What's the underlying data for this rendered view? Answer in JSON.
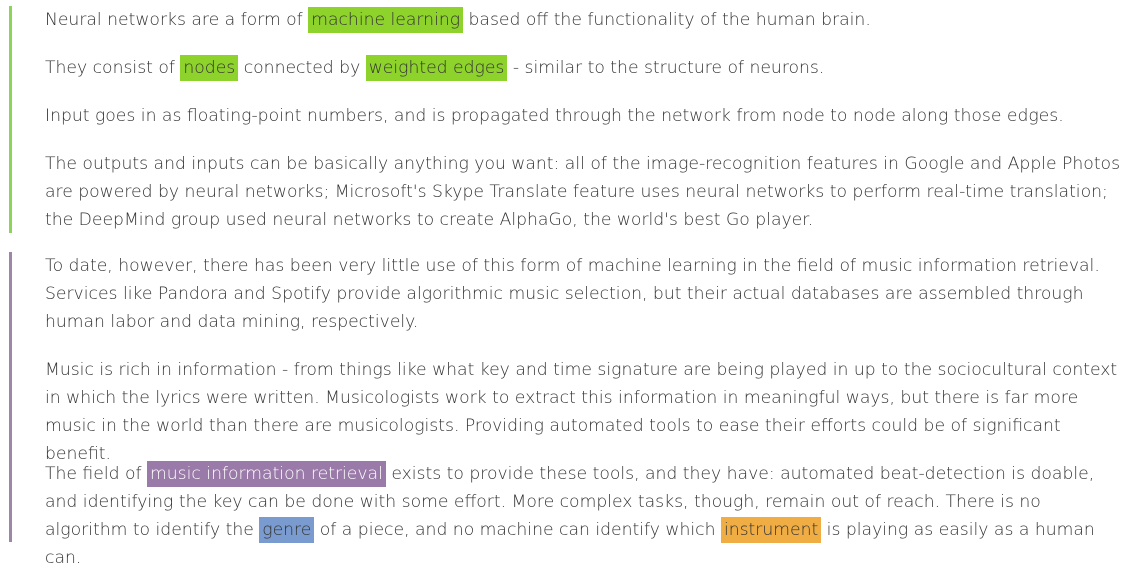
{
  "colors": {
    "section1_bar": "#8dd45a",
    "section2_bar": "#9e86a8",
    "green_highlight": "#8ed22c",
    "purple_highlight": "#9a7aa8",
    "blue_highlight": "#7a9bcf",
    "orange_highlight": "#f0ad44",
    "text": "#333333"
  },
  "section1": {
    "p1": {
      "before": "Neural networks are a form of ",
      "highlight": "machine learning",
      "after": " based off the functionality of the human brain."
    },
    "p2": {
      "before": "They consist of ",
      "highlight1": "nodes",
      "middle": " connected by ",
      "highlight2": "weighted edges",
      "after": " - similar to the structure of neurons."
    },
    "p3": "Input goes in as floating-point numbers, and is propagated through the network from node to node along those edges.",
    "p4": "The outputs and inputs can be basically anything you want: all of the image-recognition features in Google and Apple Photos are powered by neural networks; Microsoft's Skype Translate feature uses neural networks to perform real-time translation; the DeepMind group used neural networks to create AlphaGo, the world's best Go player."
  },
  "section2": {
    "p1": "To date, however, there has been very little use of this form of machine learning in the field of music information retrieval. Services like Pandora and Spotify provide algorithmic music selection, but their actual databases are assembled through human labor and data mining, respectively.",
    "p2": "Music is rich in information - from things like what key and time signature are being played in up to the sociocultural context in which the lyrics were written. Musicologists work to extract this information in meaningful ways, but there is far more music in the world than there are musicologists. Providing automated tools to ease their efforts could be of significant benefit.",
    "p3": {
      "before": "The field of ",
      "highlight1": "music information retrieval",
      "middle1": " exists to provide these tools, and they have: automated beat-detection is doable, and identifying the key can be done with some effort. More complex tasks, though, remain out of reach. There is no algorithm to identify the ",
      "highlight2": "genre",
      "middle2": " of a piece, and no machine can identify which ",
      "highlight3": "instrument",
      "after": " is playing as easily as a human can."
    }
  }
}
